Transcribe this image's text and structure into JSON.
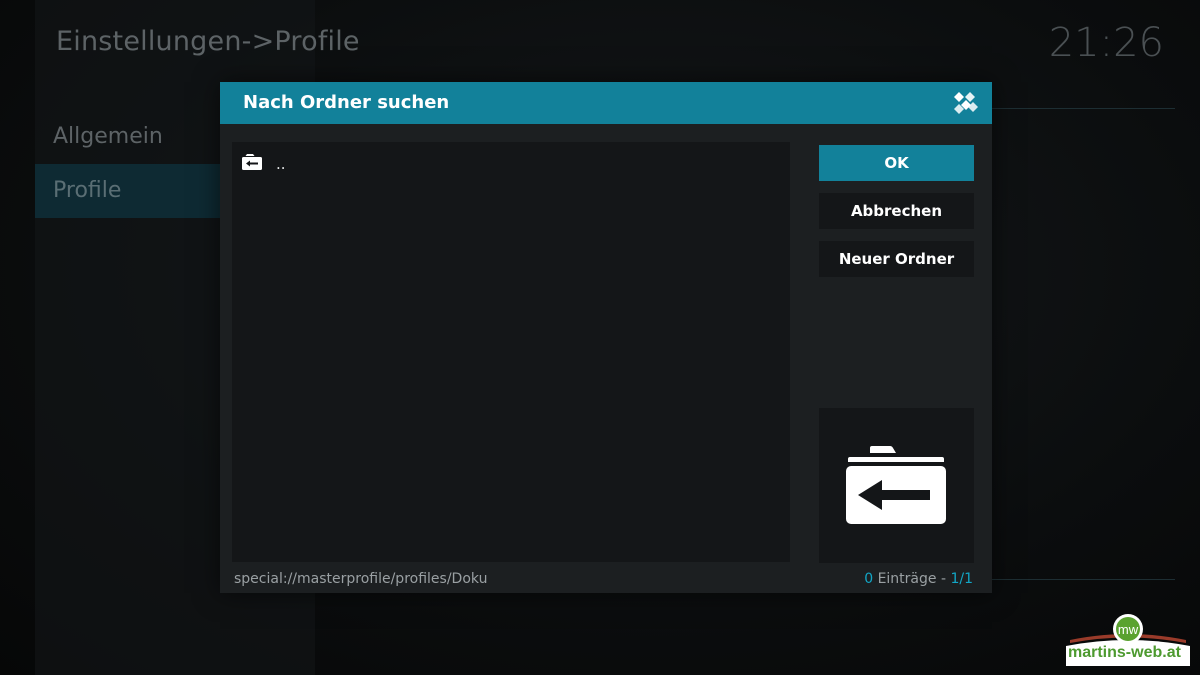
{
  "background": {
    "page_title": "Einstellungen->Profile",
    "clock": "21:26",
    "menu": [
      {
        "label": "Allgemein",
        "selected": false
      },
      {
        "label": "Profile",
        "selected": true
      }
    ]
  },
  "dialog": {
    "title": "Nach Ordner suchen",
    "logo_icon": "kodi-logo-icon",
    "list_items": [
      {
        "label": "..",
        "icon": "folder-back-icon"
      }
    ],
    "buttons": {
      "ok": "OK",
      "cancel": "Abbrechen",
      "new_folder": "Neuer Ordner"
    },
    "thumbnail_icon": "folder-back-icon",
    "footer": {
      "path": "special://masterprofile/profiles/Doku",
      "count": "0",
      "count_label": " Einträge - ",
      "page": "1/1"
    }
  },
  "watermark": {
    "text": "martins-web.at",
    "badge": "mw"
  },
  "colors": {
    "accent": "#12819a",
    "accent_text": "#12a6c6",
    "dialog_bg": "#1c1f21",
    "panel_bg": "#141618"
  }
}
